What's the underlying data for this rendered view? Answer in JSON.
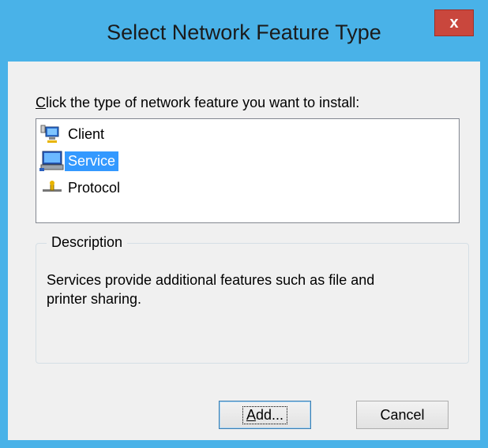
{
  "window": {
    "title": "Select Network Feature Type",
    "close_label": "x"
  },
  "prompt": {
    "text_prefix": "C",
    "text_rest": "lick the type of network feature you want to install:"
  },
  "list": {
    "items": [
      {
        "label": "Client",
        "icon": "network-client-icon",
        "selected": false
      },
      {
        "label": "Service",
        "icon": "network-service-icon",
        "selected": true
      },
      {
        "label": "Protocol",
        "icon": "network-protocol-icon",
        "selected": false
      }
    ]
  },
  "description": {
    "legend": "Description",
    "line1": "Services provide additional features such as file and",
    "line2": "printer sharing."
  },
  "buttons": {
    "add_prefix": "A",
    "add_rest": "dd...",
    "cancel": "Cancel"
  },
  "colors": {
    "chrome": "#49b2e8",
    "close": "#c9473d",
    "selection": "#3399ff"
  }
}
